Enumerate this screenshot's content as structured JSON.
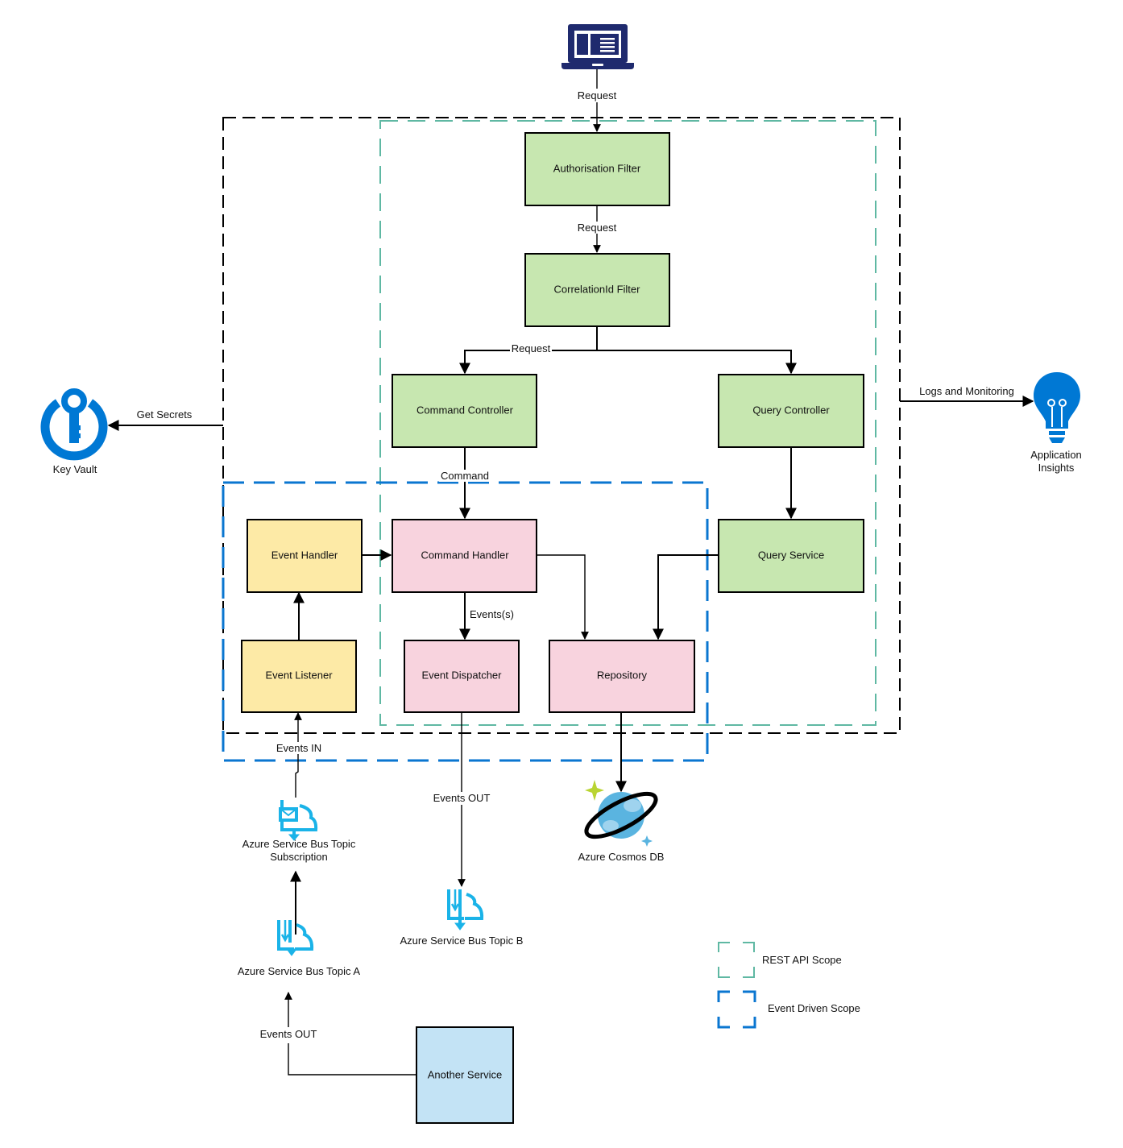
{
  "colors": {
    "green_fill": "#c7e7b0",
    "pink_fill": "#f8d3de",
    "yellow_fill": "#fdeaa6",
    "blue_fill": "#c3e3f5",
    "azure_blue": "#0078d4",
    "service_bus_cyan": "#1ab3e8",
    "rest_scope": "#5fb8a3",
    "event_scope": "#0a76d0",
    "outer_scope": "#000000"
  },
  "nodes": {
    "client": {
      "label": "",
      "icon": "laptop-icon"
    },
    "auth_filter": {
      "label": "Authorisation Filter"
    },
    "correlation_filter": {
      "label": "CorrelationId Filter"
    },
    "command_controller": {
      "label": "Command Controller"
    },
    "query_controller": {
      "label": "Query Controller"
    },
    "event_handler": {
      "label": "Event Handler"
    },
    "command_handler": {
      "label": "Command Handler"
    },
    "query_service": {
      "label": "Query Service"
    },
    "event_listener": {
      "label": "Event Listener"
    },
    "event_dispatcher": {
      "label": "Event Dispatcher"
    },
    "repository": {
      "label": "Repository"
    },
    "another_service": {
      "label": "Another Service"
    },
    "key_vault": {
      "label": "Key Vault",
      "icon": "key-vault-icon"
    },
    "app_insights": {
      "label_line1": "Application",
      "label_line2": "Insights",
      "icon": "lightbulb-icon"
    },
    "cosmos_db": {
      "label": "Azure Cosmos DB",
      "icon": "cosmos-db-icon"
    },
    "sb_subscription": {
      "label_line1": "Azure Service Bus Topic",
      "label_line2": "Subscription",
      "icon": "service-bus-subscription-icon"
    },
    "sb_topic_a": {
      "label": "Azure Service Bus Topic A",
      "icon": "service-bus-topic-icon"
    },
    "sb_topic_b": {
      "label": "Azure Service Bus Topic B",
      "icon": "service-bus-topic-icon"
    }
  },
  "edges": {
    "client_to_auth": "Request",
    "auth_to_correlation": "Request",
    "correlation_to_controllers": "Request",
    "controller_to_handler": "Command",
    "handler_to_dispatcher": "Events(s)",
    "get_secrets": "Get Secrets",
    "logs_monitoring": "Logs and Monitoring",
    "events_in": "Events IN",
    "events_out_b": "Events OUT",
    "events_out_a": "Events OUT"
  },
  "legend": {
    "rest_api_scope": "REST API Scope",
    "event_driven_scope": "Event Driven Scope"
  }
}
